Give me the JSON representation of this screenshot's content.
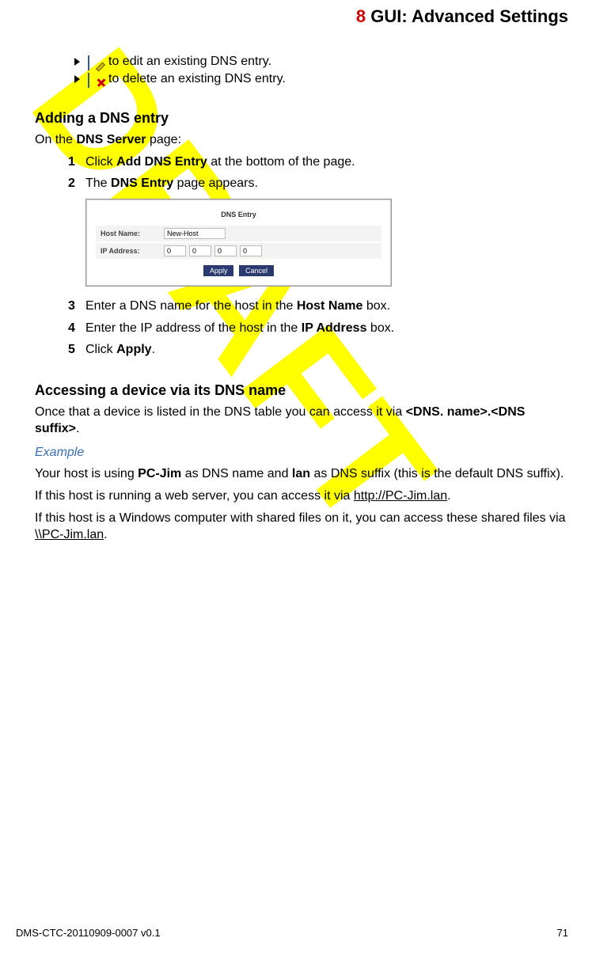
{
  "header": {
    "chapter_num": "8",
    "chapter_title": "GUI: Advanced Settings"
  },
  "intro_bullets": {
    "edit": "to edit an existing DNS entry.",
    "delete": "to delete an existing DNS entry."
  },
  "sections": {
    "adding": {
      "title": "Adding a DNS entry",
      "lead_pre": "On the ",
      "lead_bold": "DNS Server",
      "lead_post": " page:",
      "steps": {
        "s1_pre": "Click ",
        "s1_b": "Add DNS Entry",
        "s1_post": " at the bottom of the page.",
        "s2_pre": "The ",
        "s2_b": "DNS Entry",
        "s2_post": " page appears.",
        "s3_pre": "Enter a DNS name for the host in the ",
        "s3_b": "Host Name",
        "s3_post": " box.",
        "s4_pre": "Enter the IP address of the host in the ",
        "s4_b": "IP Address",
        "s4_post": " box.",
        "s5_pre": "Click ",
        "s5_b": "Apply",
        "s5_post": "."
      }
    },
    "accessing": {
      "title": "Accessing a device via its DNS name",
      "p1_pre": "Once that a device is listed in the DNS table you can access it via ",
      "p1_b": "<DNS. name>.<DNS suffix>",
      "p1_post": ".",
      "example_label": "Example",
      "p2_a": "Your host is using ",
      "p2_b1": "PC-Jim",
      "p2_b": " as DNS name and ",
      "p2_b2": "lan",
      "p2_c": " as DNS suffix (this is the default DNS suffix).",
      "p3_a": "If this host is running a web server, you can access it via ",
      "p3_link": "http://PC-Jim.lan",
      "p3_b": ".",
      "p4_a": "If this host is a Windows computer with shared files on it, you can access these shared files via ",
      "p4_link": "\\\\PC-Jim.lan",
      "p4_b": "."
    }
  },
  "screenshot": {
    "title": "DNS Entry",
    "host_label": "Host Name:",
    "host_value": "New-Host",
    "ip_label": "IP Address:",
    "ip_oct1": "0",
    "ip_oct2": "0",
    "ip_oct3": "0",
    "ip_oct4": "0",
    "btn_apply": "Apply",
    "btn_cancel": "Cancel"
  },
  "footer": {
    "left": "DMS-CTC-20110909-0007 v0.1",
    "right": "71"
  },
  "watermark": "DRAFT"
}
